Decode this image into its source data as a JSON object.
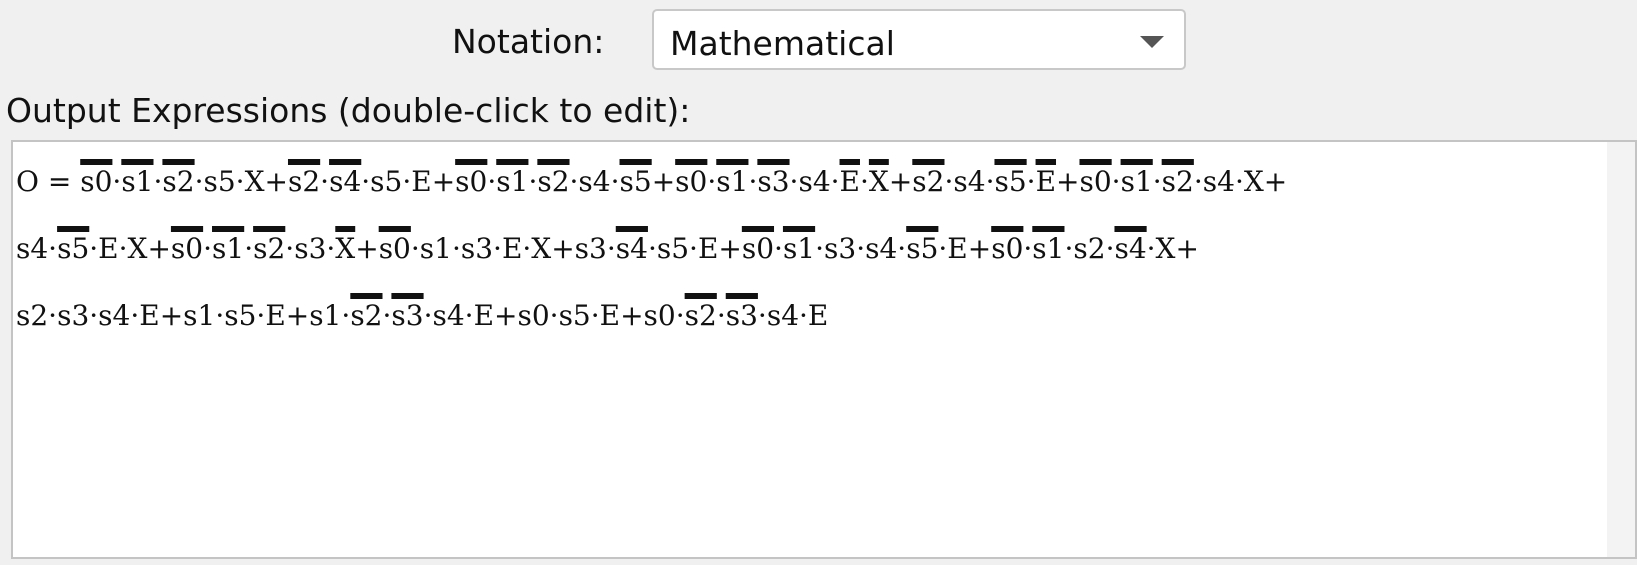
{
  "notation": {
    "label": "Notation:",
    "selected": "Mathematical"
  },
  "output": {
    "label": "Output Expressions (double-click to edit):",
    "lines": [
      [
        {
          "t": "O = ",
          "n": false
        },
        {
          "t": "s0",
          "n": true
        },
        {
          "t": "·",
          "n": false
        },
        {
          "t": "s1",
          "n": true
        },
        {
          "t": "·",
          "n": false
        },
        {
          "t": "s2",
          "n": true
        },
        {
          "t": "·s5·X+",
          "n": false
        },
        {
          "t": "s2",
          "n": true
        },
        {
          "t": "·",
          "n": false
        },
        {
          "t": "s4",
          "n": true
        },
        {
          "t": "·s5·E+",
          "n": false
        },
        {
          "t": "s0",
          "n": true
        },
        {
          "t": "·",
          "n": false
        },
        {
          "t": "s1",
          "n": true
        },
        {
          "t": "·",
          "n": false
        },
        {
          "t": "s2",
          "n": true
        },
        {
          "t": "·s4·",
          "n": false
        },
        {
          "t": "s5",
          "n": true
        },
        {
          "t": "+",
          "n": false
        },
        {
          "t": "s0",
          "n": true
        },
        {
          "t": "·",
          "n": false
        },
        {
          "t": "s1",
          "n": true
        },
        {
          "t": "·",
          "n": false
        },
        {
          "t": "s3",
          "n": true
        },
        {
          "t": "·s4·",
          "n": false
        },
        {
          "t": "E",
          "n": true
        },
        {
          "t": "·",
          "n": false
        },
        {
          "t": "X",
          "n": true
        },
        {
          "t": "+",
          "n": false
        },
        {
          "t": "s2",
          "n": true
        },
        {
          "t": "·s4·",
          "n": false
        },
        {
          "t": "s5",
          "n": true
        },
        {
          "t": "·",
          "n": false
        },
        {
          "t": "E",
          "n": true
        },
        {
          "t": "+",
          "n": false
        },
        {
          "t": "s0",
          "n": true
        },
        {
          "t": "·",
          "n": false
        },
        {
          "t": "s1",
          "n": true
        },
        {
          "t": "·",
          "n": false
        },
        {
          "t": "s2",
          "n": true
        },
        {
          "t": "·s4·X+",
          "n": false
        }
      ],
      [
        {
          "t": "s4·",
          "n": false
        },
        {
          "t": "s5",
          "n": true
        },
        {
          "t": "·E·X+",
          "n": false
        },
        {
          "t": "s0",
          "n": true
        },
        {
          "t": "·",
          "n": false
        },
        {
          "t": "s1",
          "n": true
        },
        {
          "t": "·",
          "n": false
        },
        {
          "t": "s2",
          "n": true
        },
        {
          "t": "·s3·",
          "n": false
        },
        {
          "t": "X",
          "n": true
        },
        {
          "t": "+",
          "n": false
        },
        {
          "t": "s0",
          "n": true
        },
        {
          "t": "·s1·s3·E·X+s3·",
          "n": false
        },
        {
          "t": "s4",
          "n": true
        },
        {
          "t": "·s5·E+",
          "n": false
        },
        {
          "t": "s0",
          "n": true
        },
        {
          "t": "·",
          "n": false
        },
        {
          "t": "s1",
          "n": true
        },
        {
          "t": "·s3·s4·",
          "n": false
        },
        {
          "t": "s5",
          "n": true
        },
        {
          "t": "·E+",
          "n": false
        },
        {
          "t": "s0",
          "n": true
        },
        {
          "t": "·",
          "n": false
        },
        {
          "t": "s1",
          "n": true
        },
        {
          "t": "·s2·",
          "n": false
        },
        {
          "t": "s4",
          "n": true
        },
        {
          "t": "·X+",
          "n": false
        }
      ],
      [
        {
          "t": "s2·s3·s4·E+s1·s5·E+s1·",
          "n": false
        },
        {
          "t": "s2",
          "n": true
        },
        {
          "t": "·",
          "n": false
        },
        {
          "t": "s3",
          "n": true
        },
        {
          "t": "·s4·E+s0·s5·E+s0·",
          "n": false
        },
        {
          "t": "s2",
          "n": true
        },
        {
          "t": "·",
          "n": false
        },
        {
          "t": "s3",
          "n": true
        },
        {
          "t": "·s4·E",
          "n": false
        }
      ]
    ]
  }
}
